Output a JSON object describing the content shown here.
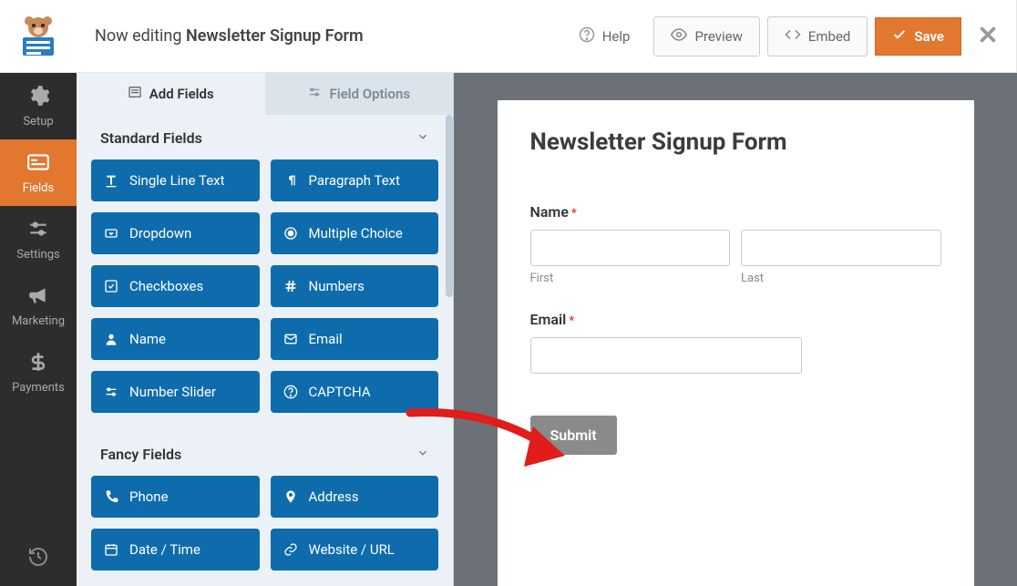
{
  "topbar": {
    "editing_prefix": "Now editing ",
    "form_name": "Newsletter Signup Form",
    "help": "Help",
    "preview": "Preview",
    "embed": "Embed",
    "save": "Save"
  },
  "sidebar": {
    "items": [
      {
        "label": "Setup"
      },
      {
        "label": "Fields"
      },
      {
        "label": "Settings"
      },
      {
        "label": "Marketing"
      },
      {
        "label": "Payments"
      }
    ]
  },
  "panel": {
    "tabs": {
      "add_fields": "Add Fields",
      "field_options": "Field Options"
    },
    "sections": {
      "standard": "Standard Fields",
      "fancy": "Fancy Fields"
    },
    "fields": {
      "single_line": "Single Line Text",
      "paragraph": "Paragraph Text",
      "dropdown": "Dropdown",
      "multiple_choice": "Multiple Choice",
      "checkboxes": "Checkboxes",
      "numbers": "Numbers",
      "name": "Name",
      "email": "Email",
      "number_slider": "Number Slider",
      "captcha": "CAPTCHA",
      "phone": "Phone",
      "address": "Address",
      "date_time": "Date / Time",
      "website": "Website / URL"
    }
  },
  "preview": {
    "title": "Newsletter Signup Form",
    "name_label": "Name",
    "first": "First",
    "last": "Last",
    "email_label": "Email",
    "submit": "Submit"
  }
}
